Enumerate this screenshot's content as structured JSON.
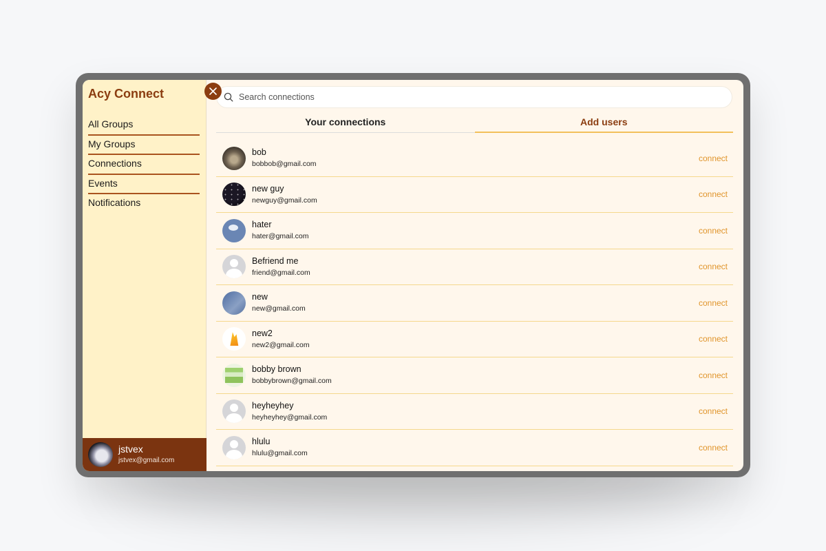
{
  "app": {
    "title": "Acy Connect"
  },
  "sidebar": {
    "items": [
      {
        "label": "All Groups"
      },
      {
        "label": "My Groups"
      },
      {
        "label": "Connections"
      },
      {
        "label": "Events"
      },
      {
        "label": "Notifications"
      }
    ],
    "user": {
      "name": "jstvex",
      "email": "jstvex@gmail.com",
      "avatar": "white-cat-photo"
    },
    "close_icon": "close-icon"
  },
  "search": {
    "placeholder": "Search connections",
    "value": "",
    "icon": "search-icon"
  },
  "tabs": [
    {
      "label": "Your connections",
      "active": false
    },
    {
      "label": "Add users",
      "active": true
    }
  ],
  "users": [
    {
      "name": "bob",
      "email": "bobbob@gmail.com",
      "action": "connect",
      "avatar": "cat-photo"
    },
    {
      "name": "new guy",
      "email": "newguy@gmail.com",
      "action": "connect",
      "avatar": "starry-sky-photo"
    },
    {
      "name": "hater",
      "email": "hater@gmail.com",
      "action": "connect",
      "avatar": "blue-illustration"
    },
    {
      "name": "Befriend me",
      "email": "friend@gmail.com",
      "action": "connect",
      "avatar": "default-avatar"
    },
    {
      "name": "new",
      "email": "new@gmail.com",
      "action": "connect",
      "avatar": "sky-photo"
    },
    {
      "name": "new2",
      "email": "new2@gmail.com",
      "action": "connect",
      "avatar": "firebase-logo"
    },
    {
      "name": "bobby brown",
      "email": "bobbybrown@gmail.com",
      "action": "connect",
      "avatar": "green-screenshot"
    },
    {
      "name": "heyheyhey",
      "email": "heyheyhey@gmail.com",
      "action": "connect",
      "avatar": "default-avatar"
    },
    {
      "name": "hlulu",
      "email": "hlulu@gmail.com",
      "action": "connect",
      "avatar": "default-avatar"
    }
  ],
  "colors": {
    "brand": "#8b3d10",
    "sidebar_bg": "#fff2c8",
    "main_bg": "#fff7ec",
    "accent": "#e0942a",
    "active_tab_underline": "#f2c05a",
    "user_card_bg": "#7b3410"
  }
}
